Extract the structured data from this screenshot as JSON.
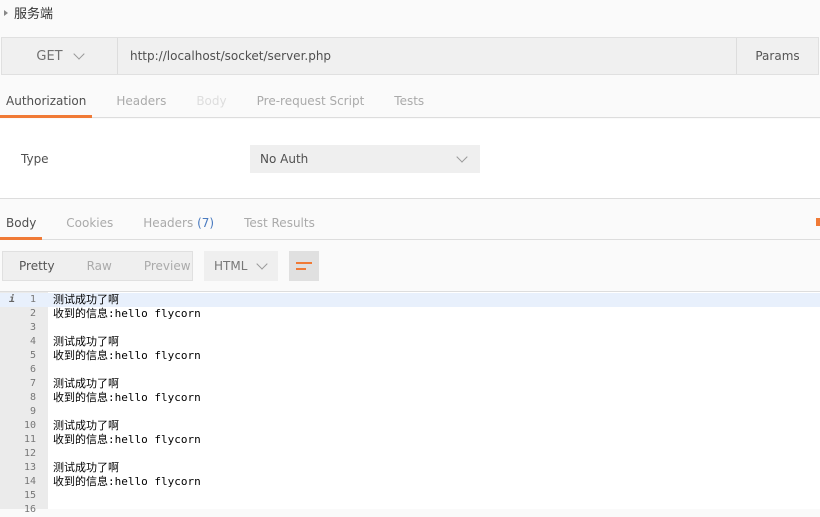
{
  "request": {
    "name": "服务端",
    "method": "GET",
    "url": "http://localhost/socket/server.php",
    "params_label": "Params"
  },
  "request_tabs": [
    {
      "label": "Authorization",
      "state": "active"
    },
    {
      "label": "Headers",
      "state": "normal"
    },
    {
      "label": "Body",
      "state": "disabled"
    },
    {
      "label": "Pre-request Script",
      "state": "normal"
    },
    {
      "label": "Tests",
      "state": "normal"
    }
  ],
  "auth": {
    "type_label": "Type",
    "type_value": "No Auth"
  },
  "response_tabs": [
    {
      "label": "Body",
      "state": "active"
    },
    {
      "label": "Cookies",
      "state": "normal"
    },
    {
      "label": "Headers",
      "count": "(7)",
      "state": "normal"
    },
    {
      "label": "Test Results",
      "state": "normal"
    }
  ],
  "view_modes": [
    {
      "label": "Pretty",
      "active": true
    },
    {
      "label": "Raw",
      "active": false
    },
    {
      "label": "Preview",
      "active": false
    }
  ],
  "format": "HTML",
  "accent_color": "#f07a36",
  "code_lines": [
    "测试成功了啊",
    "收到的信息:hello flycorn",
    "",
    "测试成功了啊",
    "收到的信息:hello flycorn",
    "",
    "测试成功了啊",
    "收到的信息:hello flycorn",
    "",
    "测试成功了啊",
    "收到的信息:hello flycorn",
    "",
    "测试成功了啊",
    "收到的信息:hello flycorn",
    "",
    ""
  ],
  "line_numbers": [
    "1",
    "2",
    "3",
    "4",
    "5",
    "6",
    "7",
    "8",
    "9",
    "10",
    "11",
    "12",
    "13",
    "14",
    "15",
    "16"
  ]
}
